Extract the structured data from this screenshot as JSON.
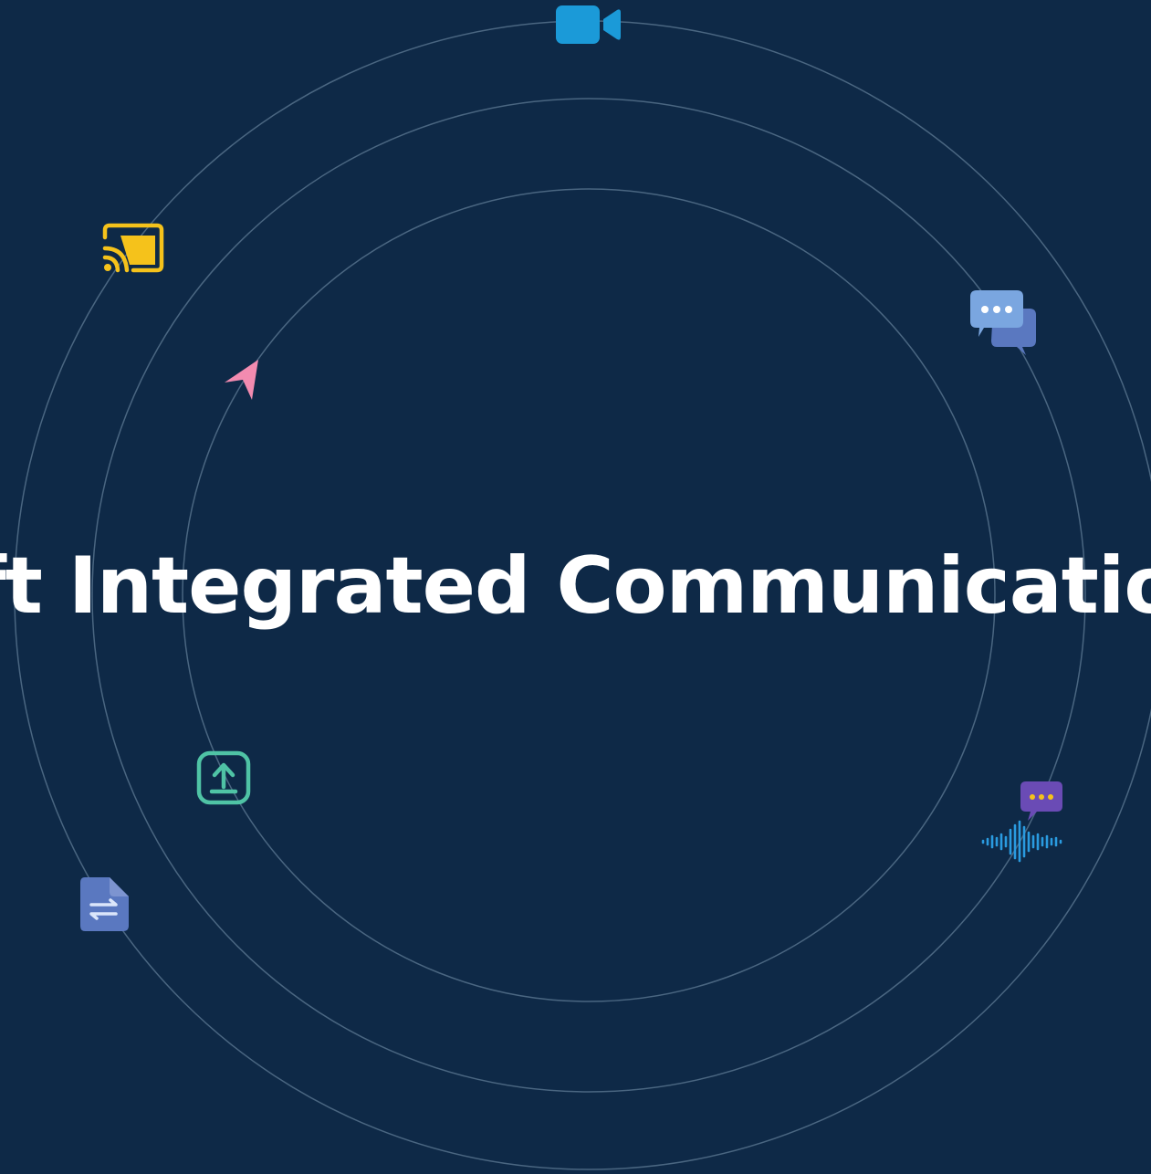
{
  "hero": {
    "headline": "oft Integrated Communication"
  },
  "icons": [
    {
      "name": "video-camera-icon",
      "color": "#1b9ad8"
    },
    {
      "name": "cast-icon",
      "color": "#f5c21b"
    },
    {
      "name": "chat-bubbles-icon",
      "color": "#7aa6e0"
    },
    {
      "name": "send-arrow-icon",
      "color": "#f28bb0"
    },
    {
      "name": "upload-icon",
      "color": "#4fc3a5"
    },
    {
      "name": "voice-message-icon",
      "color": "#6a4bb5"
    },
    {
      "name": "file-transfer-icon",
      "color": "#5a78c0"
    }
  ],
  "colors": {
    "background": "#0e2947",
    "orbit": "#4a6681",
    "text": "#ffffff"
  }
}
